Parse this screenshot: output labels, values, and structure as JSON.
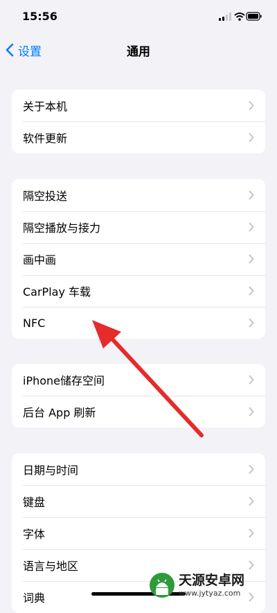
{
  "status_bar": {
    "time": "15:56"
  },
  "nav": {
    "back_label": "设置",
    "title": "通用"
  },
  "groups": [
    {
      "items": [
        "关于本机",
        "软件更新"
      ]
    },
    {
      "items": [
        "隔空投送",
        "隔空播放与接力",
        "画中画",
        "CarPlay 车载",
        "NFC"
      ]
    },
    {
      "items": [
        "iPhone储存空间",
        "后台 App 刷新"
      ]
    },
    {
      "items": [
        "日期与时间",
        "键盘",
        "字体",
        "语言与地区",
        "词典"
      ]
    }
  ],
  "watermark": {
    "name": "天源安卓网",
    "url": "www.jytyaz.com"
  },
  "colors": {
    "accent": "#007aff",
    "background": "#f2f2f7",
    "annotation_arrow": "#e52b2b"
  }
}
